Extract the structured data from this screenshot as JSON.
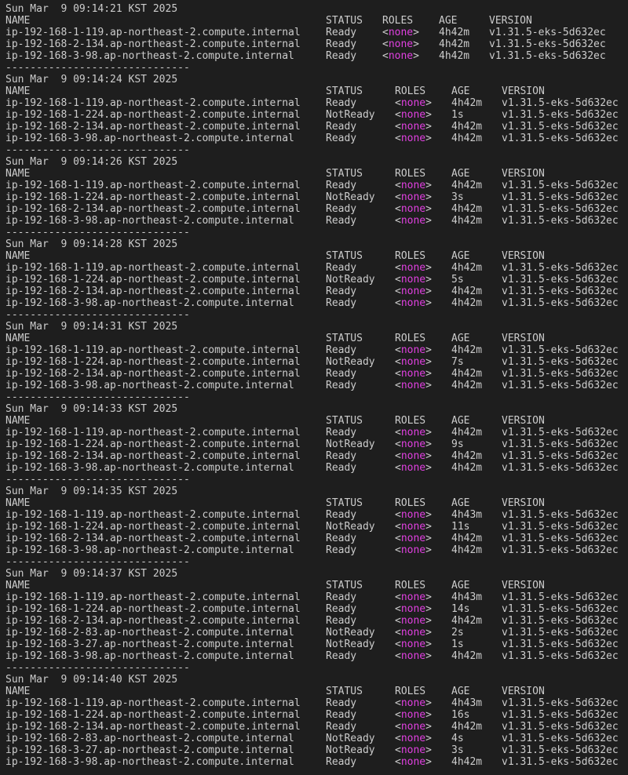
{
  "theme": {
    "background": "#1e1e1e",
    "text": "#cccccc",
    "accent_none": "#e040e0"
  },
  "header": {
    "name": "NAME",
    "status": "STATUS",
    "roles": "ROLES",
    "age": "AGE",
    "version": "VERSION"
  },
  "separator": "------------------------------",
  "blocks": [
    {
      "timestamp": "Sun Mar  9 09:14:21 KST 2025",
      "layout": "w1",
      "rows": [
        {
          "name": "ip-192-168-1-119.ap-northeast-2.compute.internal",
          "status": "Ready",
          "roles": "none",
          "age": "4h42m",
          "version": "v1.31.5-eks-5d632ec"
        },
        {
          "name": "ip-192-168-2-134.ap-northeast-2.compute.internal",
          "status": "Ready",
          "roles": "none",
          "age": "4h42m",
          "version": "v1.31.5-eks-5d632ec"
        },
        {
          "name": "ip-192-168-3-98.ap-northeast-2.compute.internal",
          "status": "Ready",
          "roles": "none",
          "age": "4h42m",
          "version": "v1.31.5-eks-5d632ec"
        }
      ]
    },
    {
      "timestamp": "Sun Mar  9 09:14:24 KST 2025",
      "layout": "w2",
      "rows": [
        {
          "name": "ip-192-168-1-119.ap-northeast-2.compute.internal",
          "status": "Ready",
          "roles": "none",
          "age": "4h42m",
          "version": "v1.31.5-eks-5d632ec"
        },
        {
          "name": "ip-192-168-1-224.ap-northeast-2.compute.internal",
          "status": "NotReady",
          "roles": "none",
          "age": "1s",
          "version": "v1.31.5-eks-5d632ec"
        },
        {
          "name": "ip-192-168-2-134.ap-northeast-2.compute.internal",
          "status": "Ready",
          "roles": "none",
          "age": "4h42m",
          "version": "v1.31.5-eks-5d632ec"
        },
        {
          "name": "ip-192-168-3-98.ap-northeast-2.compute.internal",
          "status": "Ready",
          "roles": "none",
          "age": "4h42m",
          "version": "v1.31.5-eks-5d632ec"
        }
      ]
    },
    {
      "timestamp": "Sun Mar  9 09:14:26 KST 2025",
      "layout": "w2",
      "rows": [
        {
          "name": "ip-192-168-1-119.ap-northeast-2.compute.internal",
          "status": "Ready",
          "roles": "none",
          "age": "4h42m",
          "version": "v1.31.5-eks-5d632ec"
        },
        {
          "name": "ip-192-168-1-224.ap-northeast-2.compute.internal",
          "status": "NotReady",
          "roles": "none",
          "age": "3s",
          "version": "v1.31.5-eks-5d632ec"
        },
        {
          "name": "ip-192-168-2-134.ap-northeast-2.compute.internal",
          "status": "Ready",
          "roles": "none",
          "age": "4h42m",
          "version": "v1.31.5-eks-5d632ec"
        },
        {
          "name": "ip-192-168-3-98.ap-northeast-2.compute.internal",
          "status": "Ready",
          "roles": "none",
          "age": "4h42m",
          "version": "v1.31.5-eks-5d632ec"
        }
      ]
    },
    {
      "timestamp": "Sun Mar  9 09:14:28 KST 2025",
      "layout": "w2",
      "rows": [
        {
          "name": "ip-192-168-1-119.ap-northeast-2.compute.internal",
          "status": "Ready",
          "roles": "none",
          "age": "4h42m",
          "version": "v1.31.5-eks-5d632ec"
        },
        {
          "name": "ip-192-168-1-224.ap-northeast-2.compute.internal",
          "status": "NotReady",
          "roles": "none",
          "age": "5s",
          "version": "v1.31.5-eks-5d632ec"
        },
        {
          "name": "ip-192-168-2-134.ap-northeast-2.compute.internal",
          "status": "Ready",
          "roles": "none",
          "age": "4h42m",
          "version": "v1.31.5-eks-5d632ec"
        },
        {
          "name": "ip-192-168-3-98.ap-northeast-2.compute.internal",
          "status": "Ready",
          "roles": "none",
          "age": "4h42m",
          "version": "v1.31.5-eks-5d632ec"
        }
      ]
    },
    {
      "timestamp": "Sun Mar  9 09:14:31 KST 2025",
      "layout": "w2",
      "rows": [
        {
          "name": "ip-192-168-1-119.ap-northeast-2.compute.internal",
          "status": "Ready",
          "roles": "none",
          "age": "4h42m",
          "version": "v1.31.5-eks-5d632ec"
        },
        {
          "name": "ip-192-168-1-224.ap-northeast-2.compute.internal",
          "status": "NotReady",
          "roles": "none",
          "age": "7s",
          "version": "v1.31.5-eks-5d632ec"
        },
        {
          "name": "ip-192-168-2-134.ap-northeast-2.compute.internal",
          "status": "Ready",
          "roles": "none",
          "age": "4h42m",
          "version": "v1.31.5-eks-5d632ec"
        },
        {
          "name": "ip-192-168-3-98.ap-northeast-2.compute.internal",
          "status": "Ready",
          "roles": "none",
          "age": "4h42m",
          "version": "v1.31.5-eks-5d632ec"
        }
      ]
    },
    {
      "timestamp": "Sun Mar  9 09:14:33 KST 2025",
      "layout": "w2",
      "rows": [
        {
          "name": "ip-192-168-1-119.ap-northeast-2.compute.internal",
          "status": "Ready",
          "roles": "none",
          "age": "4h42m",
          "version": "v1.31.5-eks-5d632ec"
        },
        {
          "name": "ip-192-168-1-224.ap-northeast-2.compute.internal",
          "status": "NotReady",
          "roles": "none",
          "age": "9s",
          "version": "v1.31.5-eks-5d632ec"
        },
        {
          "name": "ip-192-168-2-134.ap-northeast-2.compute.internal",
          "status": "Ready",
          "roles": "none",
          "age": "4h42m",
          "version": "v1.31.5-eks-5d632ec"
        },
        {
          "name": "ip-192-168-3-98.ap-northeast-2.compute.internal",
          "status": "Ready",
          "roles": "none",
          "age": "4h42m",
          "version": "v1.31.5-eks-5d632ec"
        }
      ]
    },
    {
      "timestamp": "Sun Mar  9 09:14:35 KST 2025",
      "layout": "w2",
      "rows": [
        {
          "name": "ip-192-168-1-119.ap-northeast-2.compute.internal",
          "status": "Ready",
          "roles": "none",
          "age": "4h43m",
          "version": "v1.31.5-eks-5d632ec"
        },
        {
          "name": "ip-192-168-1-224.ap-northeast-2.compute.internal",
          "status": "NotReady",
          "roles": "none",
          "age": "11s",
          "version": "v1.31.5-eks-5d632ec"
        },
        {
          "name": "ip-192-168-2-134.ap-northeast-2.compute.internal",
          "status": "Ready",
          "roles": "none",
          "age": "4h42m",
          "version": "v1.31.5-eks-5d632ec"
        },
        {
          "name": "ip-192-168-3-98.ap-northeast-2.compute.internal",
          "status": "Ready",
          "roles": "none",
          "age": "4h42m",
          "version": "v1.31.5-eks-5d632ec"
        }
      ]
    },
    {
      "timestamp": "Sun Mar  9 09:14:37 KST 2025",
      "layout": "w2",
      "rows": [
        {
          "name": "ip-192-168-1-119.ap-northeast-2.compute.internal",
          "status": "Ready",
          "roles": "none",
          "age": "4h43m",
          "version": "v1.31.5-eks-5d632ec"
        },
        {
          "name": "ip-192-168-1-224.ap-northeast-2.compute.internal",
          "status": "Ready",
          "roles": "none",
          "age": "14s",
          "version": "v1.31.5-eks-5d632ec"
        },
        {
          "name": "ip-192-168-2-134.ap-northeast-2.compute.internal",
          "status": "Ready",
          "roles": "none",
          "age": "4h42m",
          "version": "v1.31.5-eks-5d632ec"
        },
        {
          "name": "ip-192-168-2-83.ap-northeast-2.compute.internal",
          "status": "NotReady",
          "roles": "none",
          "age": "2s",
          "version": "v1.31.5-eks-5d632ec"
        },
        {
          "name": "ip-192-168-3-27.ap-northeast-2.compute.internal",
          "status": "NotReady",
          "roles": "none",
          "age": "1s",
          "version": "v1.31.5-eks-5d632ec"
        },
        {
          "name": "ip-192-168-3-98.ap-northeast-2.compute.internal",
          "status": "Ready",
          "roles": "none",
          "age": "4h42m",
          "version": "v1.31.5-eks-5d632ec"
        }
      ]
    },
    {
      "timestamp": "Sun Mar  9 09:14:40 KST 2025",
      "layout": "w2",
      "no_separator": true,
      "rows": [
        {
          "name": "ip-192-168-1-119.ap-northeast-2.compute.internal",
          "status": "Ready",
          "roles": "none",
          "age": "4h43m",
          "version": "v1.31.5-eks-5d632ec"
        },
        {
          "name": "ip-192-168-1-224.ap-northeast-2.compute.internal",
          "status": "Ready",
          "roles": "none",
          "age": "16s",
          "version": "v1.31.5-eks-5d632ec"
        },
        {
          "name": "ip-192-168-2-134.ap-northeast-2.compute.internal",
          "status": "Ready",
          "roles": "none",
          "age": "4h42m",
          "version": "v1.31.5-eks-5d632ec"
        },
        {
          "name": "ip-192-168-2-83.ap-northeast-2.compute.internal",
          "status": "NotReady",
          "roles": "none",
          "age": "4s",
          "version": "v1.31.5-eks-5d632ec"
        },
        {
          "name": "ip-192-168-3-27.ap-northeast-2.compute.internal",
          "status": "NotReady",
          "roles": "none",
          "age": "3s",
          "version": "v1.31.5-eks-5d632ec"
        },
        {
          "name": "ip-192-168-3-98.ap-northeast-2.compute.internal",
          "status": "Ready",
          "roles": "none",
          "age": "4h42m",
          "version": "v1.31.5-eks-5d632ec"
        }
      ]
    }
  ]
}
